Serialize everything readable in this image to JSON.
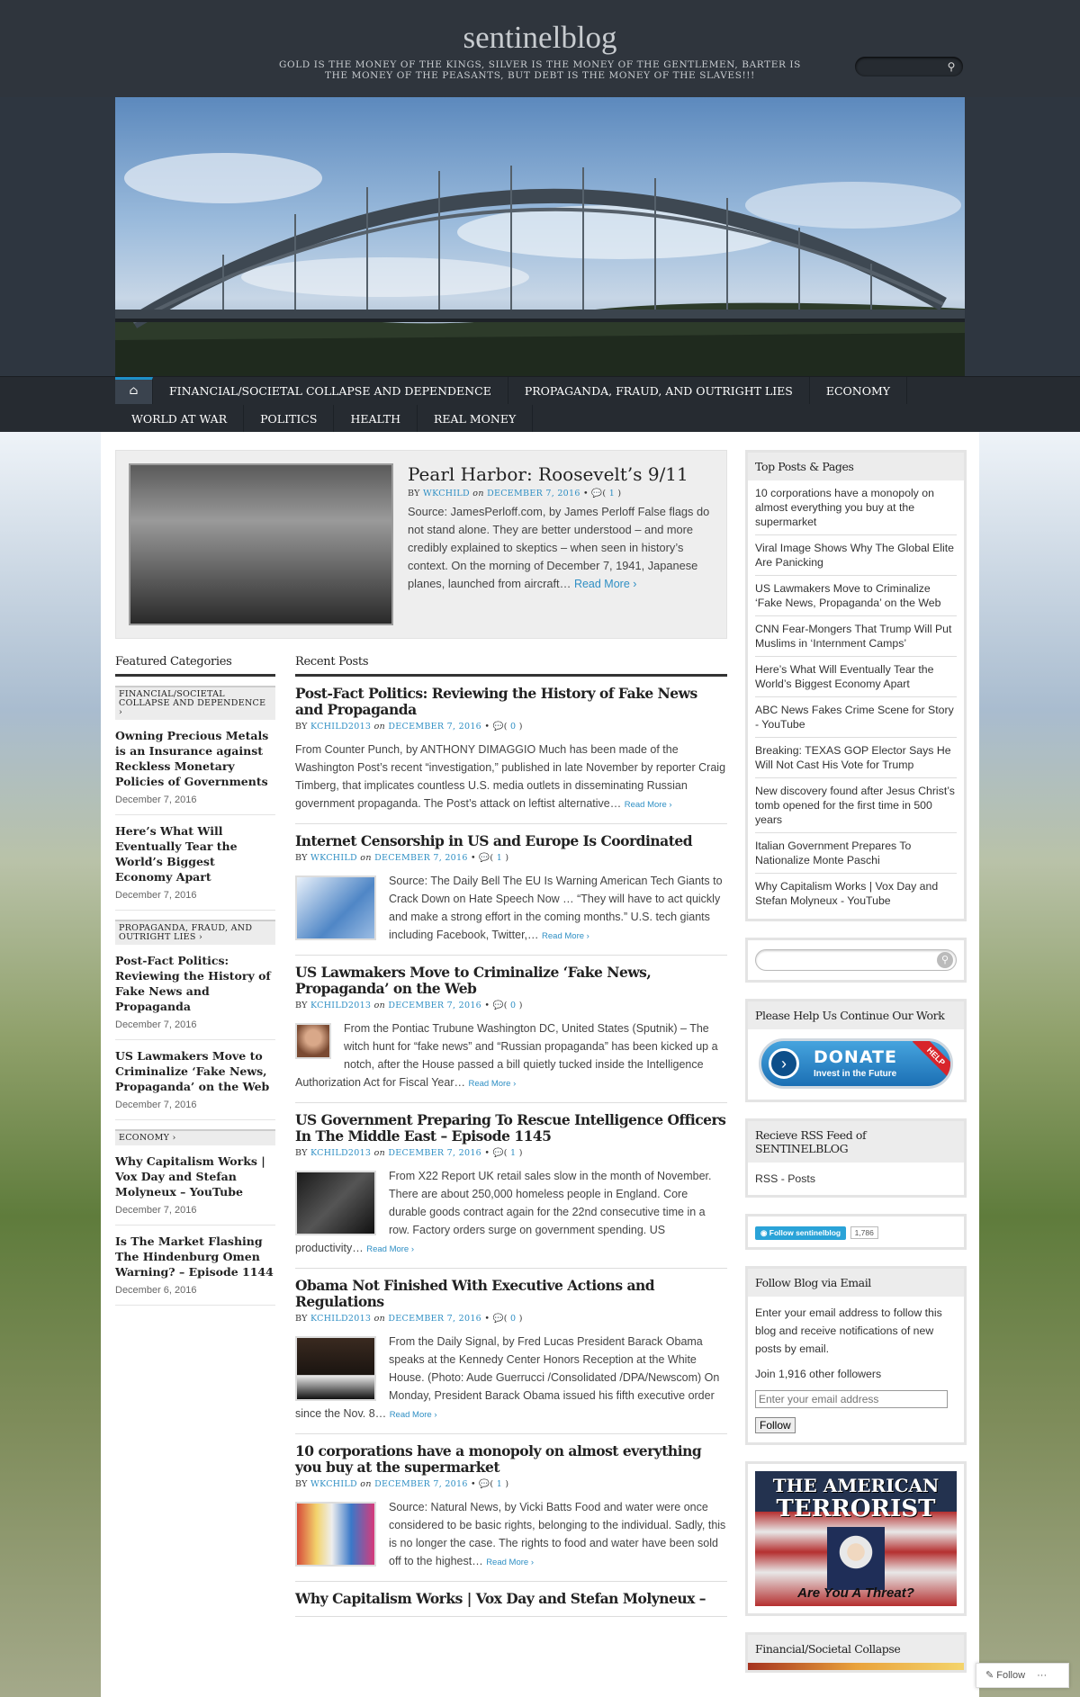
{
  "site": {
    "title": "sentinelblog",
    "tagline": "GOLD IS THE MONEY OF THE KINGS, SILVER IS THE MONEY OF THE GENTLEMEN, BARTER IS THE MONEY OF THE PEASANTS, BUT DEBT IS THE MONEY OF THE SLAVES!!!"
  },
  "nav": {
    "home_icon": "home-icon",
    "row1": [
      "FINANCIAL/SOCIETAL COLLAPSE AND DEPENDENCE",
      "PROPAGANDA, FRAUD, AND OUTRIGHT LIES",
      "ECONOMY"
    ],
    "row2": [
      "WORLD AT WAR",
      "POLITICS",
      "HEALTH",
      "REAL MONEY"
    ]
  },
  "featured": {
    "title": "Pearl Harbor: Roosevelt’s 9/11",
    "by": "BY",
    "author": "WKCHILD",
    "on": "on",
    "date": "DECEMBER 7, 2016",
    "comments": "1",
    "excerpt": "Source: JamesPerloff.com, by James Perloff False flags do not stand alone. They are better understood – and more credibly explained to skeptics – when seen in history’s context. On the morning of December 7, 1941, Japanese planes, launched from aircraft…",
    "read_more": "Read More ›"
  },
  "left": {
    "heading": "Featured Categories",
    "sections": [
      {
        "tag": "FINANCIAL/SOCIETAL COLLAPSE AND DEPENDENCE ›",
        "posts": [
          {
            "title": "Owning Precious Metals is an Insurance against Reckless Monetary Policies of Governments",
            "date": "December 7, 2016"
          },
          {
            "title": "Here’s What Will Eventually Tear the World’s Biggest Economy Apart",
            "date": "December 7, 2016"
          }
        ]
      },
      {
        "tag": "PROPAGANDA, FRAUD, AND OUTRIGHT LIES ›",
        "posts": [
          {
            "title": "Post-Fact Politics: Reviewing the History of Fake News and Propaganda",
            "date": "December 7, 2016"
          },
          {
            "title": "US Lawmakers Move to Criminalize ‘Fake News, Propaganda’ on the Web",
            "date": "December 7, 2016"
          }
        ]
      },
      {
        "tag": "ECONOMY ›",
        "posts": [
          {
            "title": "Why Capitalism Works | Vox Day and Stefan Molyneux – YouTube",
            "date": "December 7, 2016"
          },
          {
            "title": "Is The Market Flashing The Hindenburg Omen Warning? – Episode 1144",
            "date": "December 6, 2016"
          }
        ]
      }
    ]
  },
  "center": {
    "heading": "Recent Posts",
    "posts": [
      {
        "title": "Post-Fact Politics: Reviewing the History of Fake News and Propaganda",
        "author": "KCHILD2013",
        "date": "DECEMBER 7, 2016",
        "comments": "0",
        "excerpt": "From Counter Punch, by ANTHONY DIMAGGIO Much has been made of the Washington Post’s recent “investigation,” published in late November by reporter Craig Timberg, that implicates countless U.S. media outlets in disseminating Russian government propaganda.  The Post’s attack on leftist alternative…",
        "thumb": ""
      },
      {
        "title": "Internet Censorship in US and Europe Is Coordinated",
        "author": "WKCHILD",
        "date": "DECEMBER 7, 2016",
        "comments": "1",
        "excerpt": "Source: The Daily Bell The EU Is Warning American Tech Giants to Crack Down on Hate Speech Now  …  “They will have to act quickly and make a strong effort in the coming months.” U.S. tech giants including Facebook, Twitter,…",
        "thumb": "linear-gradient(135deg,#e8f0fa,#4f86c6 60%,#9bbce3)"
      },
      {
        "title": "US Lawmakers Move to Criminalize ‘Fake News, Propaganda’ on the Web",
        "author": "KCHILD2013",
        "date": "DECEMBER 7, 2016",
        "comments": "0",
        "excerpt": "From the Pontiac Trubune Washington DC, United States (Sputnik) – The witch hunt for “fake news” and “Russian propaganda” has been kicked up a notch, after the House passed a bill quietly tucked inside the Intelligence Authorization Act for Fiscal Year…",
        "thumb": "small"
      },
      {
        "title": "US Government Preparing To Rescue Intelligence Officers In The Middle East – Episode 1145",
        "author": "KCHILD2013",
        "date": "DECEMBER 7, 2016",
        "comments": "1",
        "excerpt": "From X22 Report UK retail sales slow in the month of November. There are about 250,000 homeless people in England. Core durable goods contract again for the 22nd consecutive time in a row. Factory orders surge on government spending. US productivity…",
        "thumb": "linear-gradient(135deg,#1a1a1a,#555 50%,#111)"
      },
      {
        "title": "Obama Not Finished With Executive Actions and Regulations",
        "author": "KCHILD2013",
        "date": "DECEMBER 7, 2016",
        "comments": "0",
        "excerpt": "From the Daily Signal, by Fred Lucas President Barack Obama speaks at the Kennedy Center Honors Reception at the White House. (Photo: Aude Guerrucci /Consolidated /DPA/Newscom) On Monday, President Barack Obama issued his fifth executive order since the Nov. 8…",
        "thumb": "linear-gradient(180deg,#3a2a20,#1a1410 60%,#eee 61%,#111)"
      },
      {
        "title": "10 corporations have a monopoly on almost everything you buy at the supermarket",
        "author": "WKCHILD",
        "date": "DECEMBER 7, 2016",
        "comments": "1",
        "excerpt": "Source: Natural News, by Vicki Batts Food and water were once considered to be basic rights, belonging to the individual. Sadly, this is no longer the case. The rights to food and water have been sold off to the highest…",
        "thumb": "linear-gradient(90deg,#d64a3a,#f3d36b 25%,#eee 45%,#3a78c8 70%,#d63a7a)"
      },
      {
        "title": "Why Capitalism Works | Vox Day and Stefan Molyneux –",
        "author": "",
        "date": "",
        "comments": "",
        "excerpt": "",
        "thumb": ""
      }
    ],
    "by": "BY",
    "on": "on",
    "read_more": "Read More ›"
  },
  "sidebar": {
    "top_posts": {
      "heading": "Top Posts & Pages",
      "items": [
        "10 corporations have a monopoly on almost everything you buy at the supermarket",
        "Viral Image Shows Why The Global Elite Are Panicking",
        "US Lawmakers Move to Criminalize ‘Fake News, Propaganda’ on the Web",
        "CNN Fear-Mongers That Trump Will Put Muslims in ‘Internment Camps’",
        "Here’s What Will Eventually Tear the World’s Biggest Economy Apart",
        "ABC News Fakes Crime Scene for Story - YouTube",
        "Breaking: TEXAS GOP Elector Says He Will Not Cast His Vote for Trump",
        "New discovery found after Jesus Christ’s tomb opened for the first time in 500 years",
        "Italian Government Prepares To Nationalize Monte Paschi",
        "Why Capitalism Works | Vox Day and Stefan Molyneux - YouTube"
      ]
    },
    "donate": {
      "heading": "Please Help Us Continue Our Work",
      "button": "DONATE",
      "sub": "Invest in the Future",
      "ribbon": "HELP"
    },
    "rss": {
      "heading": "Recieve RSS Feed of SENTINELBLOG",
      "link": "RSS - Posts"
    },
    "follow_btn": {
      "label": "Follow sentinelblog",
      "count": "1,786"
    },
    "email": {
      "heading": "Follow Blog via Email",
      "text": "Enter your email address to follow this blog and receive notifications of new posts by email.",
      "join": "Join 1,916 other followers",
      "placeholder": "Enter your email address",
      "button": "Follow"
    },
    "poster": {
      "line1": "THE AMERICAN",
      "line2": "TERRORIST",
      "line3": "Are You A Threat?"
    },
    "collapse": {
      "heading": "Financial/Societal Collapse"
    }
  },
  "floating_follow": {
    "label": "Follow"
  }
}
